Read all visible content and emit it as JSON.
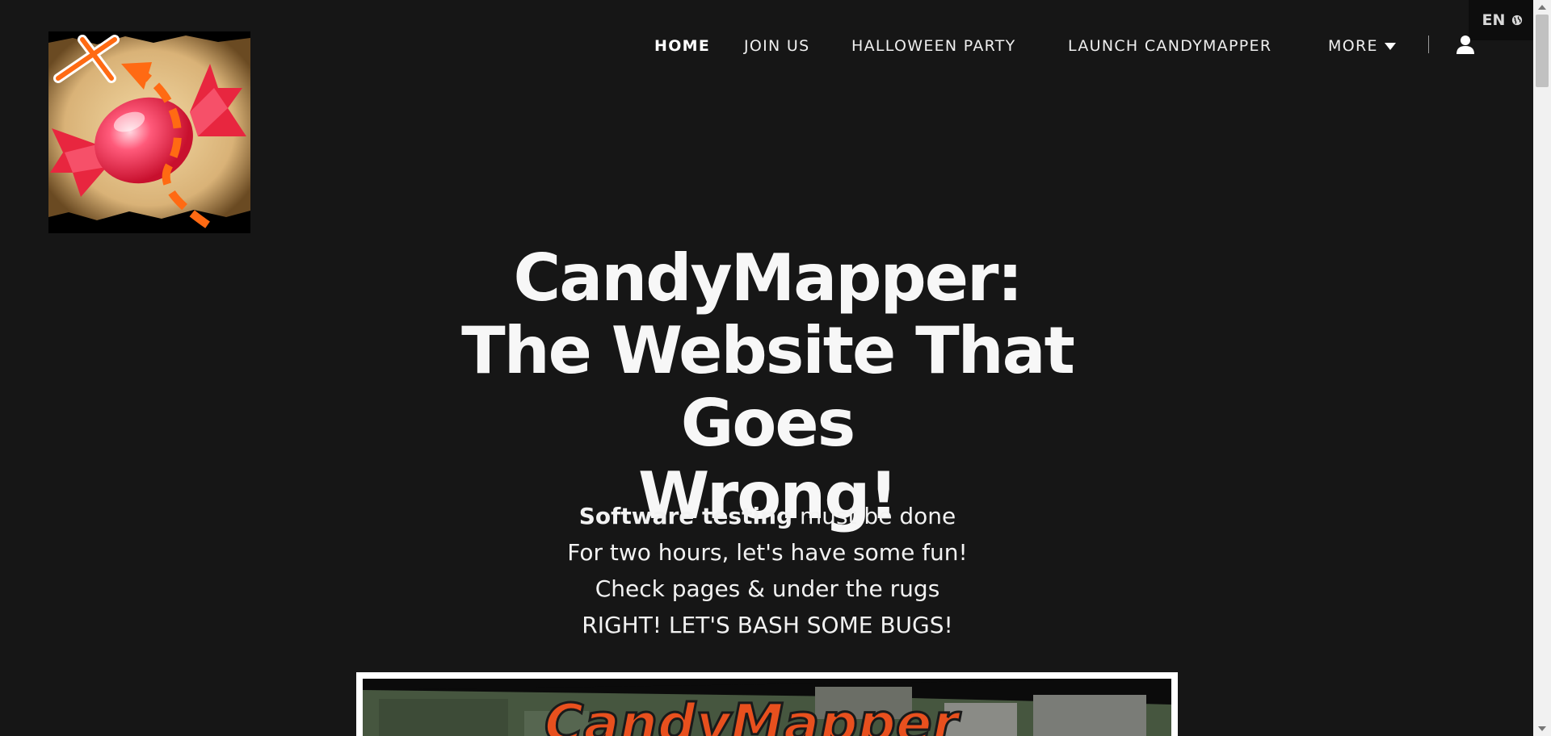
{
  "language": {
    "code": "EN",
    "icon": "globe-icon"
  },
  "nav": {
    "items": [
      {
        "label": "HOME",
        "active": true
      },
      {
        "label": "JOIN US",
        "active": false
      },
      {
        "label": "HALLOWEEN PARTY",
        "active": false
      },
      {
        "label": "LAUNCH CANDYMAPPER",
        "active": false
      },
      {
        "label": "MORE",
        "active": false
      }
    ],
    "user_icon": "user-icon",
    "more_icon": "caret-down-icon"
  },
  "hero": {
    "title_lines": [
      "CandyMapper:",
      "The Website That Goes",
      "Wrong!"
    ],
    "verse": {
      "line1_bold": "Software testing",
      "line1_rest": " must be done",
      "line2": "For two hours, let's have some fun!",
      "line3": "Check pages & under the rugs",
      "line4": "RIGHT! LET'S BASH SOME BUGS!"
    },
    "banner_text": "CandyMapper"
  },
  "colors": {
    "background": "#161616",
    "text": "#ffffff",
    "candy_red": "#e8263f",
    "path_orange": "#ff6a13"
  }
}
